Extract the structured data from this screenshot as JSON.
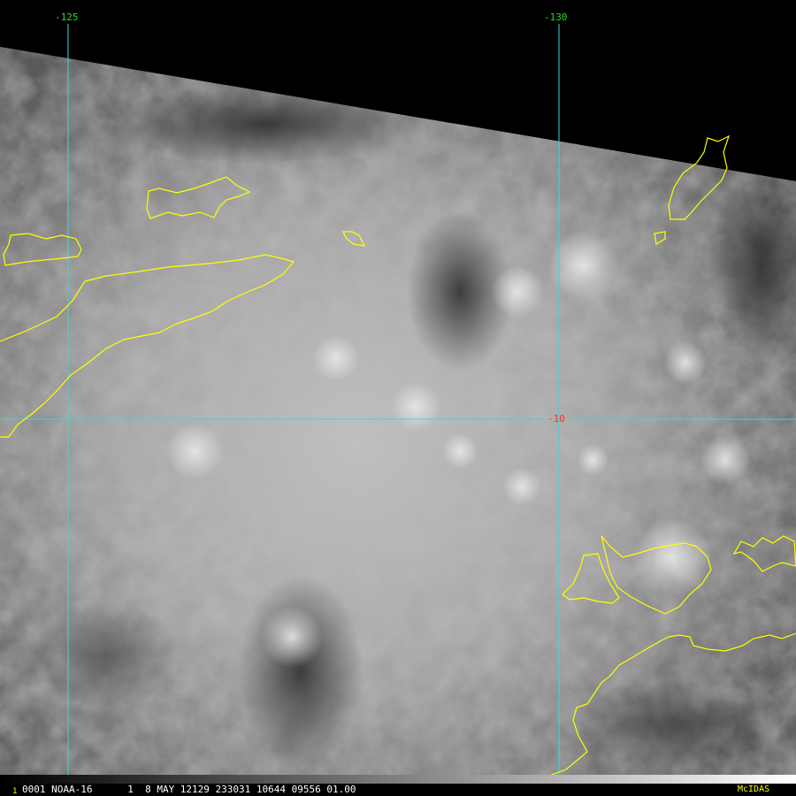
{
  "map": {
    "longitude_labels": [
      "-125",
      "-130"
    ],
    "latitude_labels": [
      "-10"
    ]
  },
  "status_bar": {
    "frame_number": "1",
    "info": "0001 NOAA-16      1  8 MAY 12129 233031 10644 09556 01.00",
    "logo": "McIDAS"
  },
  "colors": {
    "graticule": "#3fd6d6",
    "coastline": "#ffff00",
    "longitude_label": "#22dd22",
    "latitude_label": "#ff3333",
    "status_text": "#ffffff",
    "frame_number": "#ffff00",
    "logo": "#ffff00",
    "background": "#000000"
  },
  "icons": {
    "satellite_imagery": "visible-channel cloud field",
    "coastline_overlay": "island outlines"
  }
}
